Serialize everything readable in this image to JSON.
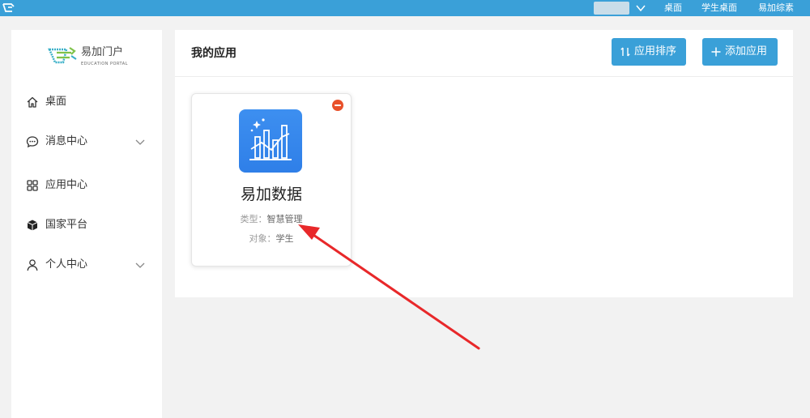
{
  "topbar": {
    "logo_icon": "portal-logo-icon",
    "links": [
      "桌面",
      "学生桌面",
      "易加综素"
    ]
  },
  "brand": {
    "name": "易加门户",
    "subtitle": "EDUCATION PORTAL"
  },
  "sidebar": {
    "items": [
      {
        "label": "桌面",
        "icon": "home-icon",
        "expandable": false
      },
      {
        "label": "消息中心",
        "icon": "message-icon",
        "expandable": true
      },
      {
        "label": "应用中心",
        "icon": "grid-icon",
        "expandable": false
      },
      {
        "label": "国家平台",
        "icon": "cube-icon",
        "expandable": false
      },
      {
        "label": "个人中心",
        "icon": "user-icon",
        "expandable": true
      }
    ]
  },
  "main": {
    "title": "我的应用",
    "sort_button": "应用排序",
    "add_button": "添加应用",
    "apps": [
      {
        "name": "易加数据",
        "type_label": "类型：",
        "type_value": "智慧管理",
        "audience_label": "对象：",
        "audience_value": "学生",
        "icon": "data-chart-icon"
      }
    ]
  },
  "colors": {
    "accent": "#3aa0d8",
    "remove": "#e8502a",
    "annotation_arrow": "#e8282a"
  }
}
